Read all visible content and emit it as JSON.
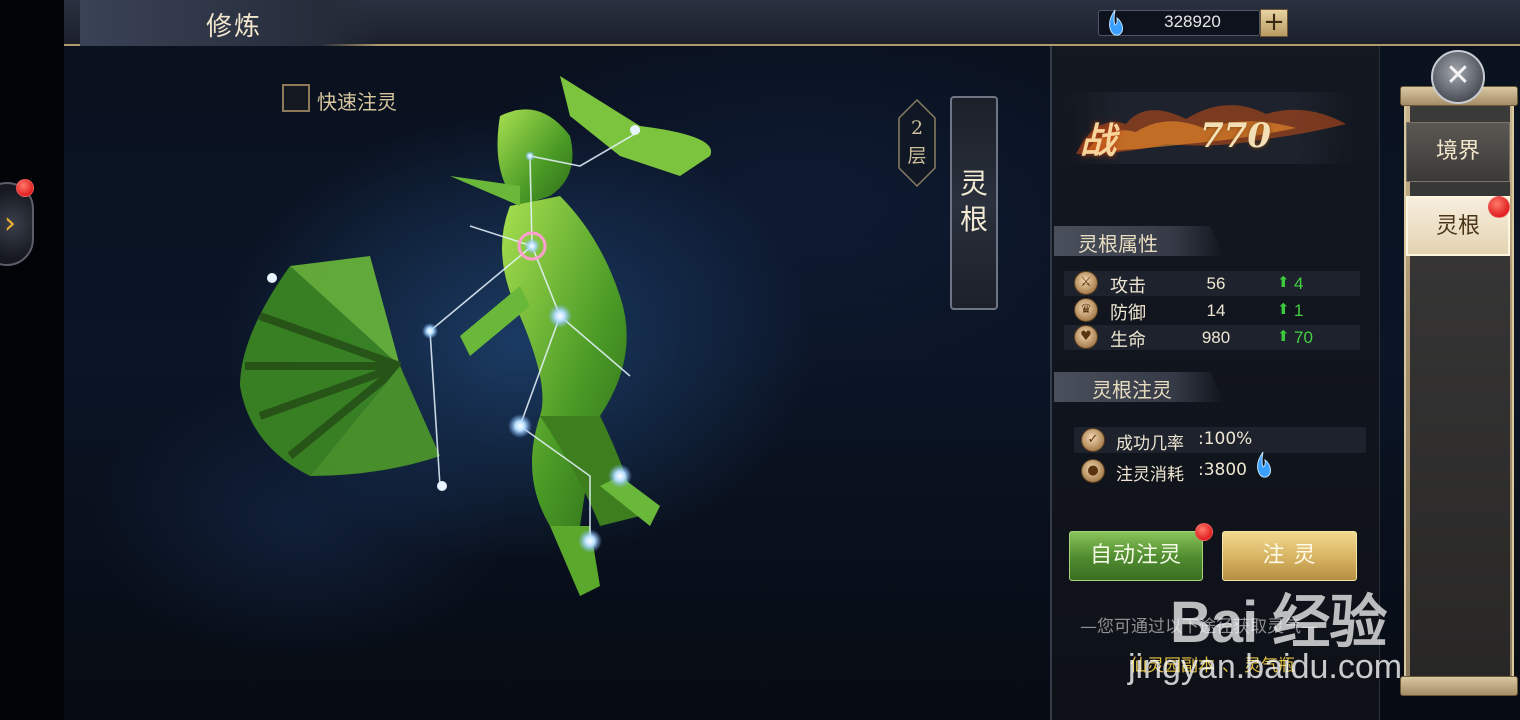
{
  "header": {
    "title": "修炼",
    "currency_value": "328920",
    "add_label": "+"
  },
  "quick_infuse": {
    "label": "快速注灵",
    "checked": false
  },
  "layer_badge": {
    "number": "2",
    "unit": "层"
  },
  "spirit_root_banner": {
    "label": "灵根"
  },
  "combat_power": {
    "char": "战",
    "value": "770"
  },
  "attributes": {
    "title": "灵根属性",
    "rows": [
      {
        "name": "攻击",
        "value": "56",
        "bonus": "4",
        "icon": "sword-icon"
      },
      {
        "name": "防御",
        "value": "14",
        "bonus": "1",
        "icon": "shield-icon"
      },
      {
        "name": "生命",
        "value": "980",
        "bonus": "70",
        "icon": "heart-icon"
      }
    ]
  },
  "infusion": {
    "title": "灵根注灵",
    "success_label": "成功几率",
    "success_value": ":100%",
    "cost_label": "注灵消耗",
    "cost_value": ":3800"
  },
  "buttons": {
    "auto_infuse": "自动注灵",
    "infuse": "注 灵"
  },
  "hint": {
    "text": "—您可通过以下途径获取灵气—",
    "source_1": "仙灵园副本",
    "source_sep": "、",
    "source_2": "灵气瓶"
  },
  "tabs": [
    {
      "label": "境界",
      "active": false
    },
    {
      "label": "灵根",
      "active": true
    }
  ],
  "watermark": {
    "brand": "Bai 经验",
    "url": "jingyan.baidu.com"
  },
  "colors": {
    "accent_gold": "#e3c240",
    "bonus_green": "#42d042",
    "notify_red": "#e02020",
    "figure_green": "#5fb830"
  }
}
